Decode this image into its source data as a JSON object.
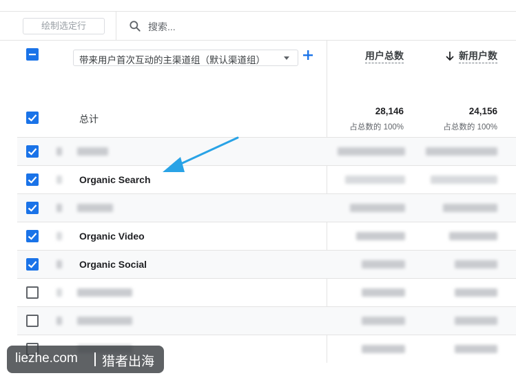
{
  "toolbar": {
    "plot_button": "绘制选定行",
    "search_placeholder": "搜索..."
  },
  "dimension": {
    "selected": "带来用户首次互动的主渠道组（默认渠道组）"
  },
  "metrics": {
    "total_users_header": "用户总数",
    "new_users_header": "新用户数",
    "sort": "descending-new-users"
  },
  "totals": {
    "label": "总计",
    "total_users": "28,146",
    "total_users_share": "占总数的 100%",
    "new_users": "24,156",
    "new_users_share": "占总数的 100%"
  },
  "rows": [
    {
      "label": "",
      "checked": true
    },
    {
      "label": "Organic Search",
      "checked": true
    },
    {
      "label": "",
      "checked": true
    },
    {
      "label": "Organic Video",
      "checked": true
    },
    {
      "label": "Organic Social",
      "checked": true
    },
    {
      "label": "",
      "checked": false
    },
    {
      "label": "",
      "checked": false
    },
    {
      "label": "",
      "checked": false
    }
  ],
  "watermark": {
    "site": "liezhe.com",
    "brand": "猎者出海"
  },
  "colors": {
    "accent": "#1a73e8",
    "annotation_arrow": "#29a3e6"
  }
}
